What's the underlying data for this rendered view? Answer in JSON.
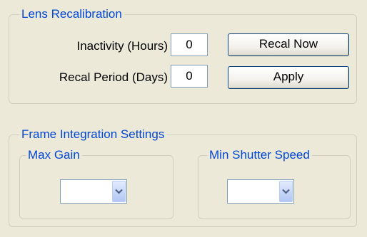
{
  "lens_recalibration": {
    "title": "Lens Recalibration",
    "inactivity_label": "Inactivity (Hours)",
    "inactivity_value": "0",
    "recal_period_label": "Recal Period (Days)",
    "recal_period_value": "0",
    "recal_now_label": "Recal Now",
    "apply_label": "Apply"
  },
  "frame_integration": {
    "title": "Frame Integration Settings",
    "max_gain": {
      "title": "Max Gain",
      "selected": ""
    },
    "min_shutter_speed": {
      "title": "Min Shutter Speed",
      "selected": ""
    }
  },
  "icons": {
    "dropdown": "chevron-down-icon"
  },
  "colors": {
    "background": "#ece9d8",
    "group_title": "#0046d5",
    "group_border": "#d0d0bf",
    "input_border": "#7f9db9",
    "button_border": "#003c74"
  }
}
